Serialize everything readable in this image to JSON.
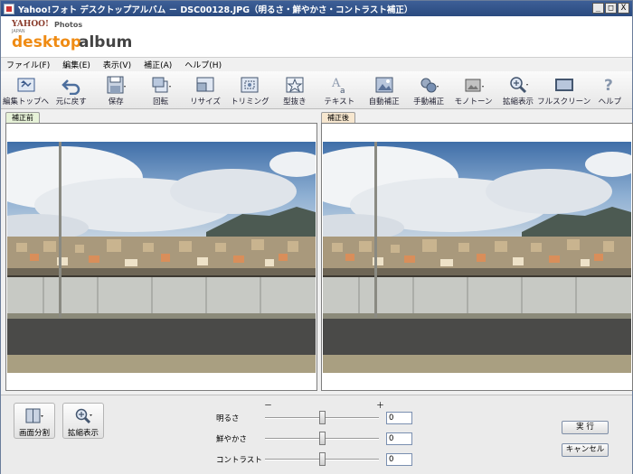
{
  "window": {
    "title": "Yahoo!フォト デスクトップアルバム － DSC00128.JPG（明るさ・鮮やかさ・コントラスト補正）",
    "minimize": "_",
    "maximize": "□",
    "close": "X"
  },
  "logo": {
    "yahoo": "YAHOO!",
    "japan": "JAPAN",
    "photos": "Photos",
    "desktop": "desktop",
    "album": "album"
  },
  "menu": [
    {
      "label": "ファイル(F)"
    },
    {
      "label": "編集(E)"
    },
    {
      "label": "表示(V)"
    },
    {
      "label": "補正(A)"
    },
    {
      "label": "ヘルプ(H)"
    }
  ],
  "toolbar": [
    {
      "label": "編集トップへ",
      "icon": "edit-top-icon"
    },
    {
      "label": "元に戻す",
      "icon": "undo-icon"
    },
    {
      "label": "保存",
      "icon": "save-icon"
    },
    {
      "label": "回転",
      "icon": "rotate-icon"
    },
    {
      "label": "リサイズ",
      "icon": "resize-icon"
    },
    {
      "label": "トリミング",
      "icon": "crop-icon"
    },
    {
      "label": "型抜き",
      "icon": "cutout-icon"
    },
    {
      "label": "テキスト",
      "icon": "text-icon"
    },
    {
      "label": "自動補正",
      "icon": "auto-correct-icon"
    },
    {
      "label": "手動補正",
      "icon": "manual-correct-icon"
    },
    {
      "label": "モノトーン",
      "icon": "monotone-icon"
    },
    {
      "label": "拡縮表示",
      "icon": "zoom-icon"
    },
    {
      "label": "フルスクリーン",
      "icon": "fullscreen-icon"
    },
    {
      "label": "ヘルプ",
      "icon": "help-icon"
    }
  ],
  "panels": {
    "before_tab": "補正前",
    "after_tab": "補正後"
  },
  "bottom": {
    "split_label": "画面分割",
    "zoom_label": "拡縮表示",
    "minus": "－",
    "plus": "＋",
    "sliders": [
      {
        "label": "明るさ",
        "value": "0",
        "level": 0.5
      },
      {
        "label": "鮮やかさ",
        "value": "0",
        "level": 0.5
      },
      {
        "label": "コントラスト",
        "value": "0",
        "level": 0.5
      }
    ],
    "run_label": "実 行",
    "cancel_label": "キャンセル"
  },
  "colors": {
    "titlebar": "#2a4a7f",
    "logo_orange": "#ef8b13",
    "before_tab": "#e7f2d8",
    "after_tab": "#f7e7cf"
  }
}
